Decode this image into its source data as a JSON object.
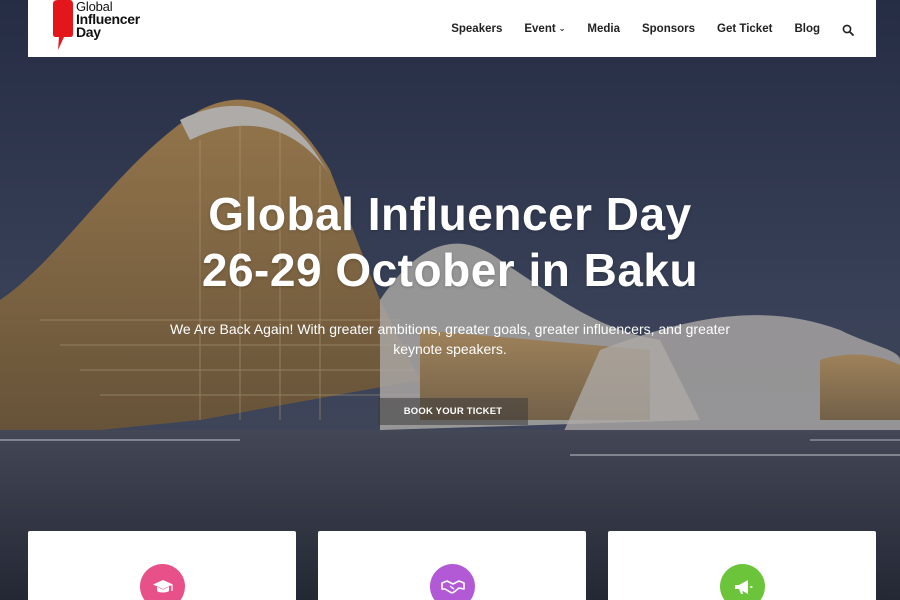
{
  "logo": {
    "line1": "Global",
    "line2": "Influencer",
    "line3": "Day",
    "brand_color": "#e3161c"
  },
  "nav": {
    "items": [
      {
        "label": "Speakers"
      },
      {
        "label": "Event",
        "has_dropdown": true
      },
      {
        "label": "Media"
      },
      {
        "label": "Sponsors"
      },
      {
        "label": "Get Ticket"
      },
      {
        "label": "Blog"
      }
    ],
    "search_icon": "search-icon"
  },
  "hero": {
    "title_line1": "Global Influencer Day",
    "title_line2": "26-29 October in Baku",
    "subtitle": "We Are Back Again! With greater ambitions, greater goals, greater influencers, and greater keynote speakers.",
    "cta_label": "BOOK YOUR TICKET"
  },
  "cards": [
    {
      "icon": "graduation-cap-icon",
      "color": "#e8508a"
    },
    {
      "icon": "handshake-icon",
      "color": "#b25ad6"
    },
    {
      "icon": "megaphone-icon",
      "color": "#6bc43a"
    }
  ]
}
